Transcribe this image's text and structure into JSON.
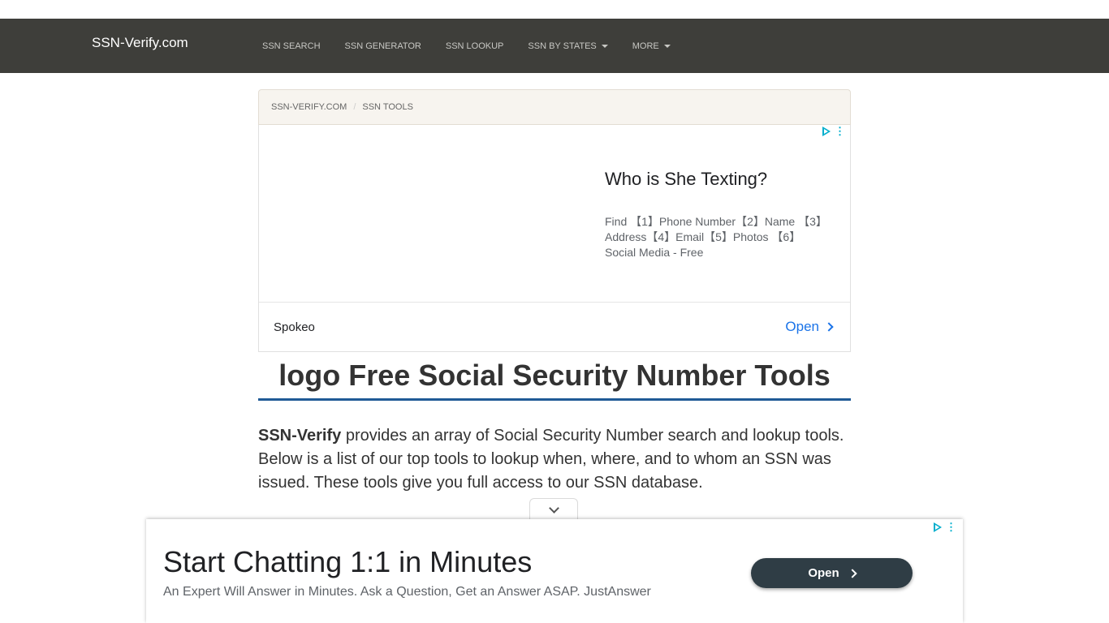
{
  "navbar": {
    "brand": "SSN-Verify.com",
    "items": [
      {
        "label": "SSN SEARCH",
        "dropdown": false
      },
      {
        "label": "SSN GENERATOR",
        "dropdown": false
      },
      {
        "label": "SSN LOOKUP",
        "dropdown": false
      },
      {
        "label": "SSN BY STATES",
        "dropdown": true
      },
      {
        "label": "MORE",
        "dropdown": true
      }
    ]
  },
  "breadcrumb": {
    "items": [
      "SSN-VERIFY.COM",
      "SSN TOOLS"
    ],
    "separator": "/"
  },
  "top_ad": {
    "headline": "Who is She Texting?",
    "description": "Find 【1】Phone Number【2】Name 【3】Address【4】Email【5】Photos 【6】Social Media - Free",
    "advertiser": "Spokeo",
    "cta": "Open"
  },
  "page_title": {
    "logo_alt": "logo",
    "text": "Free Social Security Number Tools"
  },
  "intro": {
    "brand": "SSN-Verify",
    "text": " provides an array of Social Security Number search and lookup tools. Below is a list of our top tools to lookup when, where, and to whom an SSN was issued. These tools give you full access to our SSN database."
  },
  "anchor_ad": {
    "headline": "Start Chatting 1:1 in Minutes",
    "description": "An Expert Will Answer in Minutes. Ask a Question, Get an Answer ASAP. JustAnswer",
    "cta": "Open"
  },
  "colors": {
    "navbar_bg": "#3e3e3a",
    "title_underline": "#1f5a96",
    "ad_link": "#1a73e8",
    "ad_choices": "#00aecd",
    "anchor_button": "#2f3d45"
  }
}
